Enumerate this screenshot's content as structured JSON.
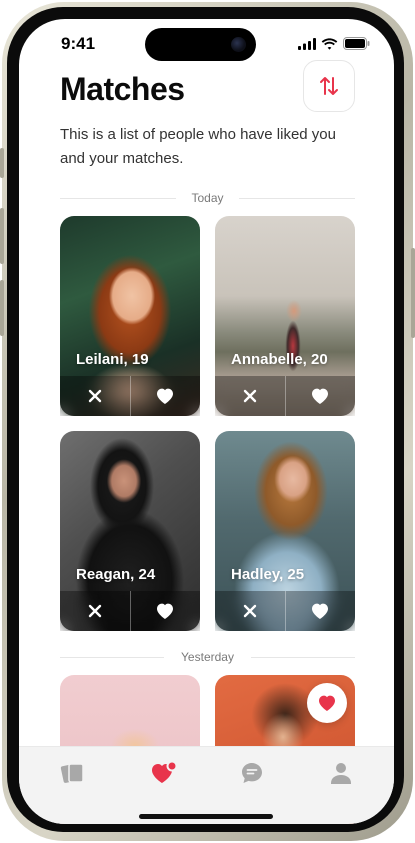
{
  "status_bar": {
    "time": "9:41"
  },
  "header": {
    "title": "Matches",
    "subtitle": "This is a list of people who have liked you and your matches."
  },
  "sections": [
    {
      "label": "Today"
    },
    {
      "label": "Yesterday"
    }
  ],
  "cards": [
    {
      "name": "Leilani, 19"
    },
    {
      "name": "Annabelle, 20"
    },
    {
      "name": "Reagan, 24"
    },
    {
      "name": "Hadley, 25"
    }
  ],
  "nav": {
    "items": [
      "cards-icon",
      "likes-icon",
      "chat-icon",
      "profile-icon"
    ],
    "active": "likes-icon"
  },
  "colors": {
    "accent": "#e8344b",
    "nav_inactive": "#a8a8a8"
  }
}
